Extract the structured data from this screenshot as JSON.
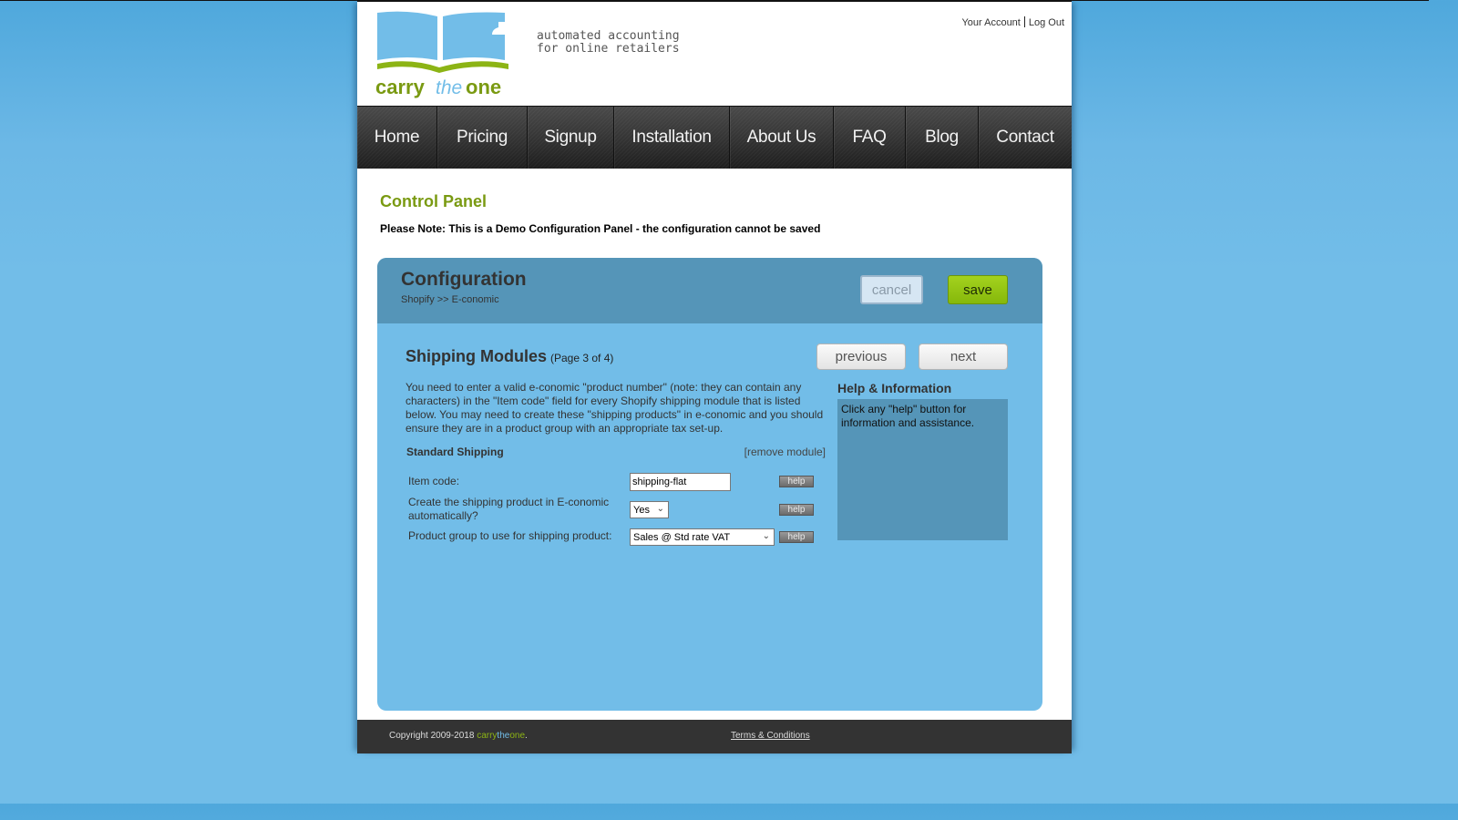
{
  "brand": {
    "logo_text": {
      "carry": "carry",
      "the": "the",
      "one": "one"
    },
    "tagline": "automated accounting\nfor online retailers",
    "colors": {
      "green": "#7a9a12",
      "blue": "#72bde8",
      "dark": "#333333"
    }
  },
  "account": {
    "your_account": "Your Account",
    "log_out": "Log Out"
  },
  "nav": {
    "items": [
      {
        "label": "Home"
      },
      {
        "label": "Pricing"
      },
      {
        "label": "Signup"
      },
      {
        "label": "Installation"
      },
      {
        "label": "About Us"
      },
      {
        "label": "FAQ"
      },
      {
        "label": "Blog"
      },
      {
        "label": "Contact"
      }
    ]
  },
  "page": {
    "title": "Control Panel",
    "note": "Please Note: This is a Demo Configuration Panel - the configuration cannot be saved"
  },
  "config": {
    "title": "Configuration",
    "breadcrumb": "Shopify >> E-conomic",
    "cancel_label": "cancel",
    "save_label": "save",
    "previous_label": "previous",
    "next_label": "next",
    "section": {
      "title": "Shipping Modules",
      "page_info": "(Page 3 of 4)",
      "intro": "You need to enter a valid e-conomic \"product number\" (note: they can contain any characters) in the \"Item code\" field for every Shopify shipping module that is listed below. You may need to create these \"shipping products\" in e-conomic and you should ensure they are in a product group with an appropriate tax set-up.",
      "module_name": "Standard Shipping",
      "remove_label": "[remove module]",
      "fields": [
        {
          "label": "Item code:",
          "type": "text",
          "value": "shipping-flat",
          "help": "help"
        },
        {
          "label": "Create the shipping product in E-conomic automatically?",
          "type": "select",
          "value": "Yes",
          "help": "help"
        },
        {
          "label": "Product group to use for shipping product:",
          "type": "select",
          "value": "Sales @ Std rate VAT",
          "help": "help"
        }
      ]
    },
    "help_panel": {
      "title": "Help & Information",
      "text": "Click any \"help\" button for information and assistance."
    }
  },
  "footer": {
    "copyright": "Copyright 2009-2018",
    "brand_carry": "carry",
    "brand_the": "the",
    "brand_one": "one",
    "brand_dot": ".",
    "terms": "Terms & Conditions"
  }
}
